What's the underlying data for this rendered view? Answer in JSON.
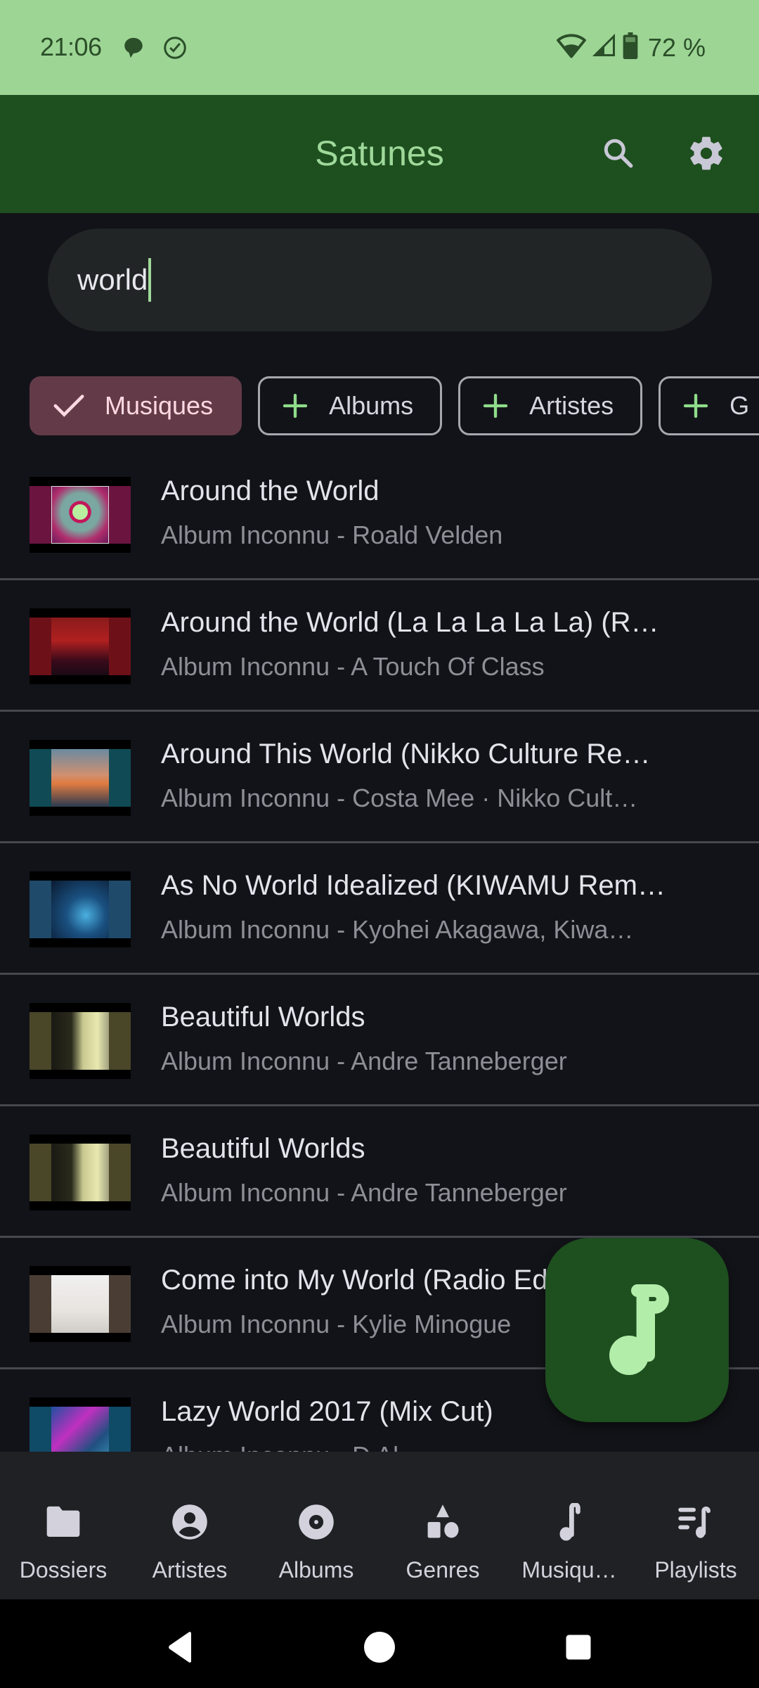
{
  "status_bar": {
    "time": "21:06",
    "battery_percent": "72 %",
    "left_icons": [
      "chat-bubble-icon",
      "check-circle-icon"
    ],
    "right_icons": [
      "wifi-icon",
      "signal-icon",
      "battery-icon"
    ]
  },
  "app_bar": {
    "title": "Satunes",
    "actions": [
      "search-icon",
      "settings-gear-icon"
    ]
  },
  "search": {
    "value": "world",
    "placeholder": ""
  },
  "filter_chips": [
    {
      "label": "Musiques",
      "selected": true,
      "icon": "check-icon"
    },
    {
      "label": "Albums",
      "selected": false,
      "icon": "plus-icon"
    },
    {
      "label": "Artistes",
      "selected": false,
      "icon": "plus-icon"
    },
    {
      "label": "G",
      "selected": false,
      "icon": "plus-icon"
    }
  ],
  "results": [
    {
      "title": "Around the World",
      "subtitle": "Album Inconnu - Roald Velden"
    },
    {
      "title": "Around the World (La La La La La) (R…",
      "subtitle": "Album Inconnu - A Touch Of Class"
    },
    {
      "title": "Around This World (Nikko Culture Re…",
      "subtitle": "Album Inconnu - Costa Mee · Nikko Cult…"
    },
    {
      "title": "As No World Idealized (KIWAMU Rem…",
      "subtitle": "Album Inconnu - Kyohei Akagawa, Kiwa…"
    },
    {
      "title": "Beautiful Worlds",
      "subtitle": "Album Inconnu - Andre Tanneberger"
    },
    {
      "title": "Beautiful Worlds",
      "subtitle": "Album Inconnu - Andre Tanneberger"
    },
    {
      "title": "Come into My World (Radio Edit)",
      "subtitle": "Album Inconnu - Kylie Minogue"
    },
    {
      "title": "Lazy World 2017 (Mix Cut)",
      "subtitle": "Album Inconnu - D Al"
    }
  ],
  "fab": {
    "icon": "music-note-icon"
  },
  "bottom_nav": [
    {
      "label": "Dossiers",
      "icon": "folder-icon"
    },
    {
      "label": "Artistes",
      "icon": "artist-icon"
    },
    {
      "label": "Albums",
      "icon": "album-disc-icon"
    },
    {
      "label": "Genres",
      "icon": "shapes-icon"
    },
    {
      "label": "Musiqu…",
      "icon": "music-note-icon"
    },
    {
      "label": "Playlists",
      "icon": "playlist-icon"
    }
  ],
  "colors": {
    "status_bar": "#9dd595",
    "app_bar": "#1e4f1f",
    "accent": "#9fd99a",
    "background": "#121318",
    "selected_chip": "#633b48"
  }
}
